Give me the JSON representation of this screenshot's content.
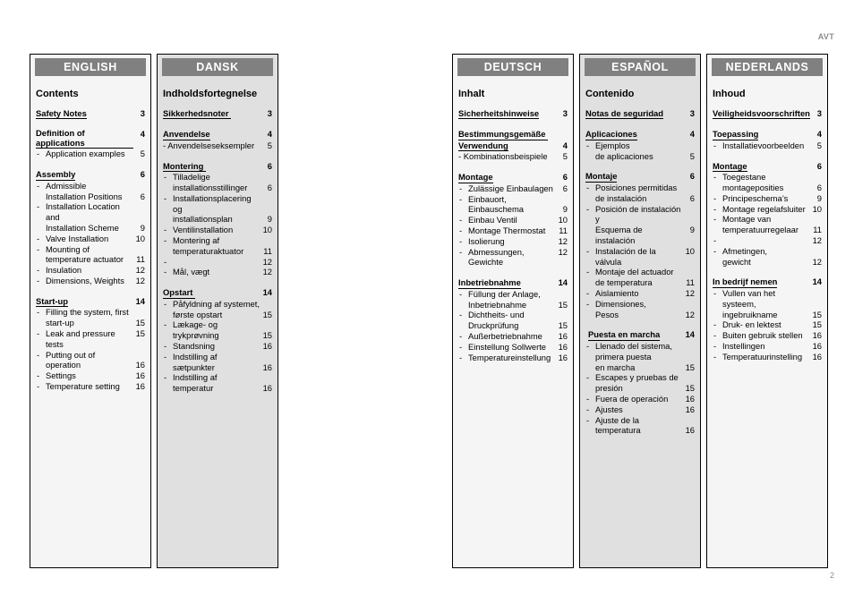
{
  "running_head": "AVT",
  "folio": "2",
  "columns": [
    {
      "id": "english",
      "language": "ENGLISH",
      "shade": "light",
      "toc_title": "Contents",
      "entries": [
        {
          "kind": "section",
          "text": "Safety Notes",
          "page": "3"
        },
        {
          "kind": "section",
          "text": "Definition of applications ",
          "page": "4"
        },
        {
          "kind": "sub",
          "text": "Application examples",
          "page": "5"
        },
        {
          "kind": "section",
          "text": "Assembly",
          "page": "6"
        },
        {
          "kind": "sub",
          "text": "Admissible",
          "page": ""
        },
        {
          "kind": "cont",
          "text": "Installation Positions",
          "page": "6"
        },
        {
          "kind": "sub",
          "text": "Installation Location and",
          "page": ""
        },
        {
          "kind": "cont",
          "text": "Installation Scheme",
          "page": "9"
        },
        {
          "kind": "sub",
          "text": "Valve Installation",
          "page": "10"
        },
        {
          "kind": "sub",
          "text": "Mounting of",
          "page": ""
        },
        {
          "kind": "cont",
          "text": "temperature actuator",
          "page": "11"
        },
        {
          "kind": "sub",
          "text": "Insulation",
          "page": "12"
        },
        {
          "kind": "sub",
          "text": "Dimensions, Weights",
          "page": "12"
        },
        {
          "kind": "section",
          "text": "Start-up",
          "page": "14"
        },
        {
          "kind": "sub",
          "text": "Filling the system, first",
          "page": ""
        },
        {
          "kind": "cont",
          "text": "start-up",
          "page": "15"
        },
        {
          "kind": "sub",
          "text": "Leak and pressure tests",
          "page": "15"
        },
        {
          "kind": "sub",
          "text": "Putting out of",
          "page": ""
        },
        {
          "kind": "cont",
          "text": "operation",
          "page": "16"
        },
        {
          "kind": "sub",
          "text": "Settings",
          "page": "16"
        },
        {
          "kind": "sub",
          "text": "Temperature setting",
          "page": "16"
        }
      ]
    },
    {
      "id": "dansk",
      "language": "DANSK",
      "shade": "dark",
      "toc_title": "Indholdsfortegnelse",
      "entries": [
        {
          "kind": "section",
          "text": "Sikkerhedsnoter ",
          "page": "3"
        },
        {
          "kind": "section",
          "text": "Anvendelse",
          "page": "4"
        },
        {
          "kind": "sub-tight",
          "text": "- Anvendelseseksempler",
          "page": "5"
        },
        {
          "kind": "section",
          "text": "Montering ",
          "page": "6"
        },
        {
          "kind": "sub",
          "text": "Tilladelige",
          "page": ""
        },
        {
          "kind": "cont",
          "text": "installationsstillinger",
          "page": "6"
        },
        {
          "kind": "sub",
          "text": "Installationsplacering og",
          "page": ""
        },
        {
          "kind": "cont",
          "text": "installationsplan",
          "page": "9"
        },
        {
          "kind": "sub",
          "text": "Ventilinstallation",
          "page": "10"
        },
        {
          "kind": "sub",
          "text": "Montering af",
          "page": ""
        },
        {
          "kind": "cont",
          "text": "temperaturaktuator",
          "page": "11"
        },
        {
          "kind": "sub",
          "text": "",
          "page": "12"
        },
        {
          "kind": "sub",
          "text": "Mål, vægt",
          "page": "12"
        },
        {
          "kind": "section",
          "text": "Opstart ",
          "page": "14"
        },
        {
          "kind": "sub",
          "text": "Påfyldning af systemet,",
          "page": ""
        },
        {
          "kind": "cont",
          "text": "første opstart",
          "page": "15"
        },
        {
          "kind": "sub",
          "text": "Lækage- og",
          "page": ""
        },
        {
          "kind": "cont",
          "text": "trykprøvning",
          "page": "15"
        },
        {
          "kind": "sub",
          "text": "Standsning",
          "page": "16"
        },
        {
          "kind": "sub",
          "text": "Indstilling af",
          "page": ""
        },
        {
          "kind": "cont",
          "text": "sætpunkter",
          "page": "16"
        },
        {
          "kind": "sub",
          "text": "Indstilling af",
          "page": ""
        },
        {
          "kind": "cont",
          "text": "temperatur",
          "page": "16"
        }
      ]
    },
    {
      "id": "deutsch",
      "language": "DEUTSCH",
      "shade": "light",
      "toc_title": "Inhalt",
      "entries": [
        {
          "kind": "section",
          "text": "Sicherheitshinweise",
          "page": "3"
        },
        {
          "kind": "section",
          "text": "Bestimmungsgemäße ",
          "page": ""
        },
        {
          "kind": "section-cont",
          "text": "Verwendung",
          "page": "4"
        },
        {
          "kind": "sub-tight",
          "text": "- Kombinationsbeispiele",
          "page": "5"
        },
        {
          "kind": "section",
          "text": "Montage",
          "page": "6"
        },
        {
          "kind": "sub",
          "text": "Zulässige Einbaulagen",
          "page": "6"
        },
        {
          "kind": "sub",
          "text": "Einbauort,",
          "page": ""
        },
        {
          "kind": "cont",
          "text": "Einbauschema",
          "page": "9"
        },
        {
          "kind": "sub",
          "text": "Einbau Ventil",
          "page": "10"
        },
        {
          "kind": "sub",
          "text": "Montage Thermostat",
          "page": "11"
        },
        {
          "kind": "sub",
          "text": "Isolierung",
          "page": "12"
        },
        {
          "kind": "sub",
          "text": "Abmessungen, Gewichte",
          "page": "12"
        },
        {
          "kind": "section",
          "text": "Inbetriebnahme",
          "page": "14"
        },
        {
          "kind": "sub",
          "text": "Füllung der Anlage,",
          "page": ""
        },
        {
          "kind": "cont",
          "text": "Inbetriebnahme",
          "page": "15"
        },
        {
          "kind": "sub",
          "text": "Dichtheits- und",
          "page": ""
        },
        {
          "kind": "cont",
          "text": "Druckprüfung",
          "page": "15"
        },
        {
          "kind": "sub",
          "text": "Außerbetriebnahme",
          "page": "16"
        },
        {
          "kind": "sub",
          "text": "Einstellung Sollwerte",
          "page": "16"
        },
        {
          "kind": "sub",
          "text": "Temperatureinstellung",
          "page": "16"
        }
      ]
    },
    {
      "id": "espanol",
      "language": "ESPAÑOL",
      "shade": "dark",
      "toc_title": "Contenido",
      "entries": [
        {
          "kind": "section",
          "text": "Notas de seguridad",
          "page": "3"
        },
        {
          "kind": "section",
          "text": "Aplicaciones",
          "page": "4"
        },
        {
          "kind": "sub",
          "text": "Ejemplos",
          "page": ""
        },
        {
          "kind": "cont",
          "text": "de aplicaciones",
          "page": "5"
        },
        {
          "kind": "section",
          "text": "Montaje",
          "page": "6"
        },
        {
          "kind": "sub",
          "text": "Posiciones permitidas",
          "page": ""
        },
        {
          "kind": "cont",
          "text": "de instalación",
          "page": "6"
        },
        {
          "kind": "sub",
          "text": "Posición de instalación y",
          "page": ""
        },
        {
          "kind": "cont",
          "text": "Esquema de instalación",
          "page": "9"
        },
        {
          "kind": "sub",
          "text": "Instalación de la válvula",
          "page": "10"
        },
        {
          "kind": "sub",
          "text": "Montaje del actuador",
          "page": ""
        },
        {
          "kind": "cont",
          "text": "de temperatura",
          "page": "11"
        },
        {
          "kind": "sub",
          "text": "Aislamiento",
          "page": "12"
        },
        {
          "kind": "sub",
          "text": "Dimensiones,",
          "page": ""
        },
        {
          "kind": "cont",
          "text": "Pesos",
          "page": "12"
        },
        {
          "kind": "section-indented",
          "text": "Puesta en marcha",
          "page": "14"
        },
        {
          "kind": "sub",
          "text": "Llenado del sistema,",
          "page": ""
        },
        {
          "kind": "cont",
          "text": "primera puesta",
          "page": ""
        },
        {
          "kind": "cont",
          "text": "en marcha",
          "page": "15"
        },
        {
          "kind": "sub",
          "text": "Escapes y pruebas de",
          "page": ""
        },
        {
          "kind": "cont",
          "text": "presión",
          "page": "15"
        },
        {
          "kind": "sub",
          "text": "Fuera de operación",
          "page": "16"
        },
        {
          "kind": "sub",
          "text": "Ajustes",
          "page": "16"
        },
        {
          "kind": "sub",
          "text": "Ajuste de la",
          "page": ""
        },
        {
          "kind": "cont",
          "text": "temperatura",
          "page": "16"
        }
      ]
    },
    {
      "id": "nederlands",
      "language": "NEDERLANDS",
      "shade": "light",
      "toc_title": "Inhoud",
      "entries": [
        {
          "kind": "section",
          "text": "Veiligheidsvoorschriften",
          "page": "3"
        },
        {
          "kind": "section",
          "text": "Toepassing",
          "page": "4"
        },
        {
          "kind": "sub",
          "text": "Installatievoorbeelden",
          "page": "5"
        },
        {
          "kind": "section",
          "text": "Montage",
          "page": "6"
        },
        {
          "kind": "sub",
          "text": "Toegestane",
          "page": ""
        },
        {
          "kind": "cont",
          "text": "montageposities",
          "page": "6"
        },
        {
          "kind": "sub",
          "text": "Principeschema’s",
          "page": "9"
        },
        {
          "kind": "sub",
          "text": "Montage regelafsluiter",
          "page": "10"
        },
        {
          "kind": "sub",
          "text": "Montage van",
          "page": ""
        },
        {
          "kind": "cont",
          "text": "temperatuurregelaar",
          "page": "11"
        },
        {
          "kind": "sub",
          "text": "",
          "page": "12"
        },
        {
          "kind": "sub",
          "text": "Afmetingen,",
          "page": ""
        },
        {
          "kind": "cont",
          "text": "gewicht",
          "page": "12"
        },
        {
          "kind": "section",
          "text": "In bedrijf nemen",
          "page": "14"
        },
        {
          "kind": "sub",
          "text": "Vullen van het systeem,",
          "page": ""
        },
        {
          "kind": "cont",
          "text": "ingebruikname",
          "page": "15"
        },
        {
          "kind": "sub",
          "text": "Druk- en lektest",
          "page": "15"
        },
        {
          "kind": "sub",
          "text": "Buiten gebruik stellen",
          "page": "16"
        },
        {
          "kind": "sub",
          "text": "Instellingen",
          "page": "16"
        },
        {
          "kind": "sub",
          "text": "Temperatuurinstelling",
          "page": "16"
        }
      ]
    }
  ]
}
